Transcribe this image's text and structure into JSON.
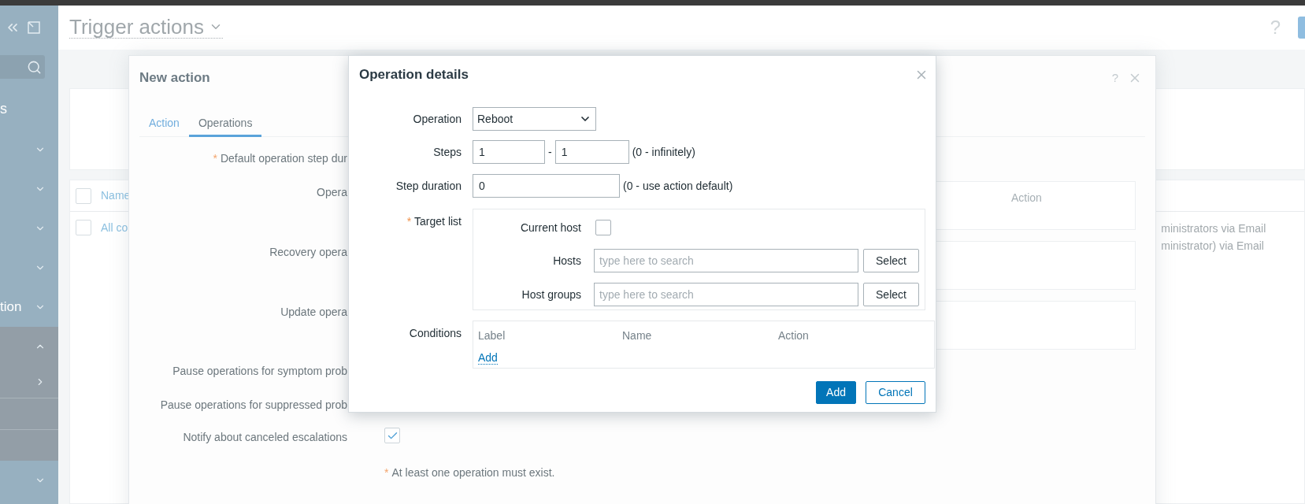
{
  "sidebar": {
    "section_title": "s",
    "items": [
      {
        "expanded": false
      },
      {
        "expanded": false
      },
      {
        "expanded": false
      },
      {
        "expanded": false
      },
      {
        "label": "tion",
        "expanded": false
      },
      {
        "expanded": true,
        "children": [
          {
            "has_submenu": true
          },
          {
            "has_submenu": false
          },
          {
            "has_submenu": false
          }
        ]
      },
      {
        "expanded": false
      }
    ]
  },
  "header": {
    "title": "Trigger actions",
    "help": "?"
  },
  "background_table": {
    "header": "Name",
    "checked": false,
    "rows": [
      {
        "name": "All co",
        "checked": false,
        "trailing_texts": [
          "ministrators via Email",
          "ministrator) via Email"
        ]
      }
    ]
  },
  "new_action": {
    "title": "New action",
    "help": "?",
    "tabs": [
      {
        "label": "Action",
        "selected": false
      },
      {
        "label": "Operations",
        "selected": true
      }
    ],
    "fields": [
      {
        "label": "Default operation step dur",
        "marker": "*",
        "kind": "covered"
      },
      {
        "label": "Opera",
        "kind": "table",
        "column": "Action"
      },
      {
        "label": "Recovery opera",
        "kind": "table"
      },
      {
        "label": "Update opera",
        "kind": "table"
      },
      {
        "label": "Pause operations for symptom prob",
        "kind": "covered"
      },
      {
        "label": "Pause operations for suppressed prob",
        "kind": "covered"
      },
      {
        "label": "Notify about canceled escalations",
        "kind": "checkbox",
        "checked": true
      }
    ],
    "note": {
      "marker": "*",
      "text": "At least one operation must exist."
    }
  },
  "operation_details": {
    "title": "Operation details",
    "operation": {
      "label": "Operation",
      "value": "Reboot"
    },
    "steps": {
      "label": "Steps",
      "from": "1",
      "separator": "-",
      "to": "1",
      "hint": "(0 - infinitely)"
    },
    "step_duration": {
      "label": "Step duration",
      "value": "0",
      "hint": "(0 - use action default)"
    },
    "target_list": {
      "label": "Target list",
      "marker": "*",
      "current_host": {
        "label": "Current host",
        "checked": false
      },
      "pickers": [
        {
          "label": "Hosts",
          "placeholder": "type here to search",
          "button": "Select"
        },
        {
          "label": "Host groups",
          "placeholder": "type here to search",
          "button": "Select"
        }
      ]
    },
    "conditions": {
      "label": "Conditions",
      "columns": [
        "Label",
        "Name",
        "Action"
      ],
      "add_link": "Add"
    },
    "buttons": [
      {
        "label": "Add",
        "kind": "primary"
      },
      {
        "label": "Cancel",
        "kind": "secondary"
      }
    ]
  }
}
